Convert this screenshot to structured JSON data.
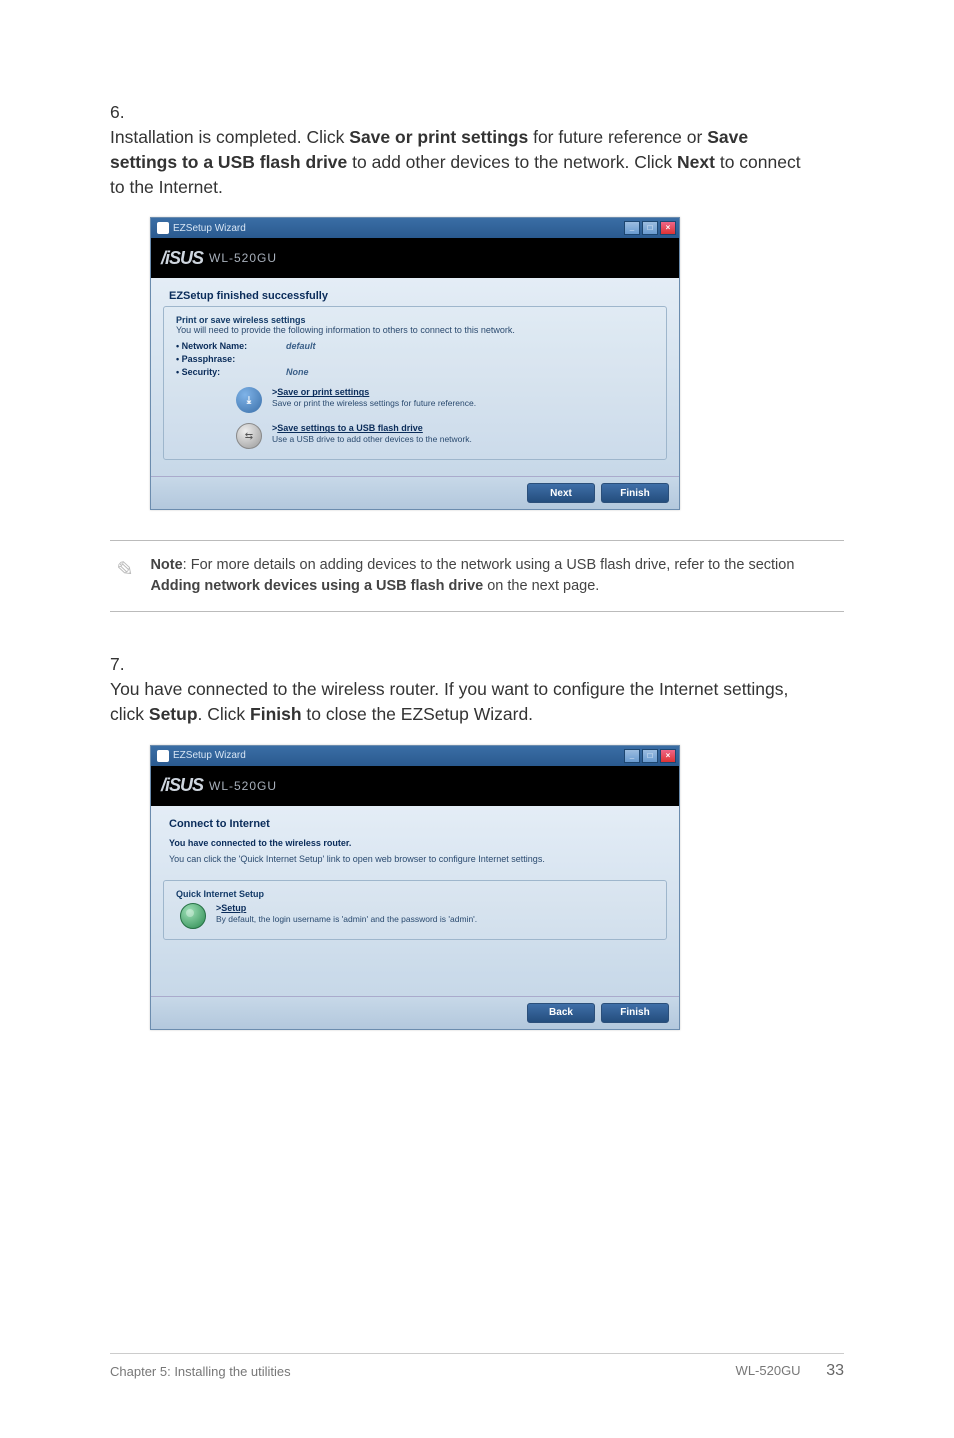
{
  "step6": {
    "num": "6.",
    "text_before_bold1": "Installation is completed. Click ",
    "bold1": "Save or print settings",
    "text_mid1": " for future reference or ",
    "bold2": "Save settings to a USB flash drive",
    "text_mid2": " to add other devices to the network. Click ",
    "bold3": "Next",
    "text_after": " to connect to the Internet."
  },
  "dialog1": {
    "title": "EZSetup Wizard",
    "model": "WL-520GU",
    "panel_title": "EZSetup finished successfully",
    "fieldset_legend": "Print or save wireless settings",
    "help": "You will need to provide the following information to others to connect to this network.",
    "rows": {
      "network_name_label": "Network Name:",
      "network_name_value": "default",
      "passphrase_label": "Passphrase:",
      "passphrase_value": "",
      "security_label": "Security:",
      "security_value": "None"
    },
    "link_save": {
      "title": "Save or print settings",
      "desc": "Save or print the wireless settings for future reference."
    },
    "link_usb": {
      "title": "Save settings to a USB flash drive",
      "desc": "Use a USB drive to add other devices to the network."
    },
    "buttons": {
      "next": "Next",
      "finish": "Finish"
    }
  },
  "note": {
    "prefix": "Note",
    "text_1": ": For more details on adding devices to the network using a USB flash drive, refer to the section ",
    "bold": "Adding network devices using a USB flash drive",
    "text_2": " on the next page."
  },
  "step7": {
    "num": "7.",
    "text1": "You have connected to the wireless router. If you want to configure the Internet settings, click ",
    "bold1": "Setup",
    "text2": ". Click ",
    "bold2": "Finish",
    "text3": " to close the EZSetup Wizard."
  },
  "dialog2": {
    "title": "EZSetup Wizard",
    "model": "WL-520GU",
    "panel_title": "Connect to Internet",
    "line1": "You have connected to the wireless router.",
    "line2": "You can click the 'Quick Internet Setup' link to open web browser to configure Internet settings.",
    "qis_legend": "Quick Internet Setup",
    "setup_link": "Setup",
    "setup_desc": "By default, the login username is 'admin' and the password is 'admin'.",
    "buttons": {
      "back": "Back",
      "finish": "Finish"
    }
  },
  "footer": {
    "left": "Chapter 5: Installing the utilities",
    "right_model": "WL-520GU",
    "page": "33"
  },
  "icons": {
    "save": "save-icon",
    "usb": "usb-icon",
    "globe": "globe-icon",
    "pencil": "pencil-icon"
  }
}
